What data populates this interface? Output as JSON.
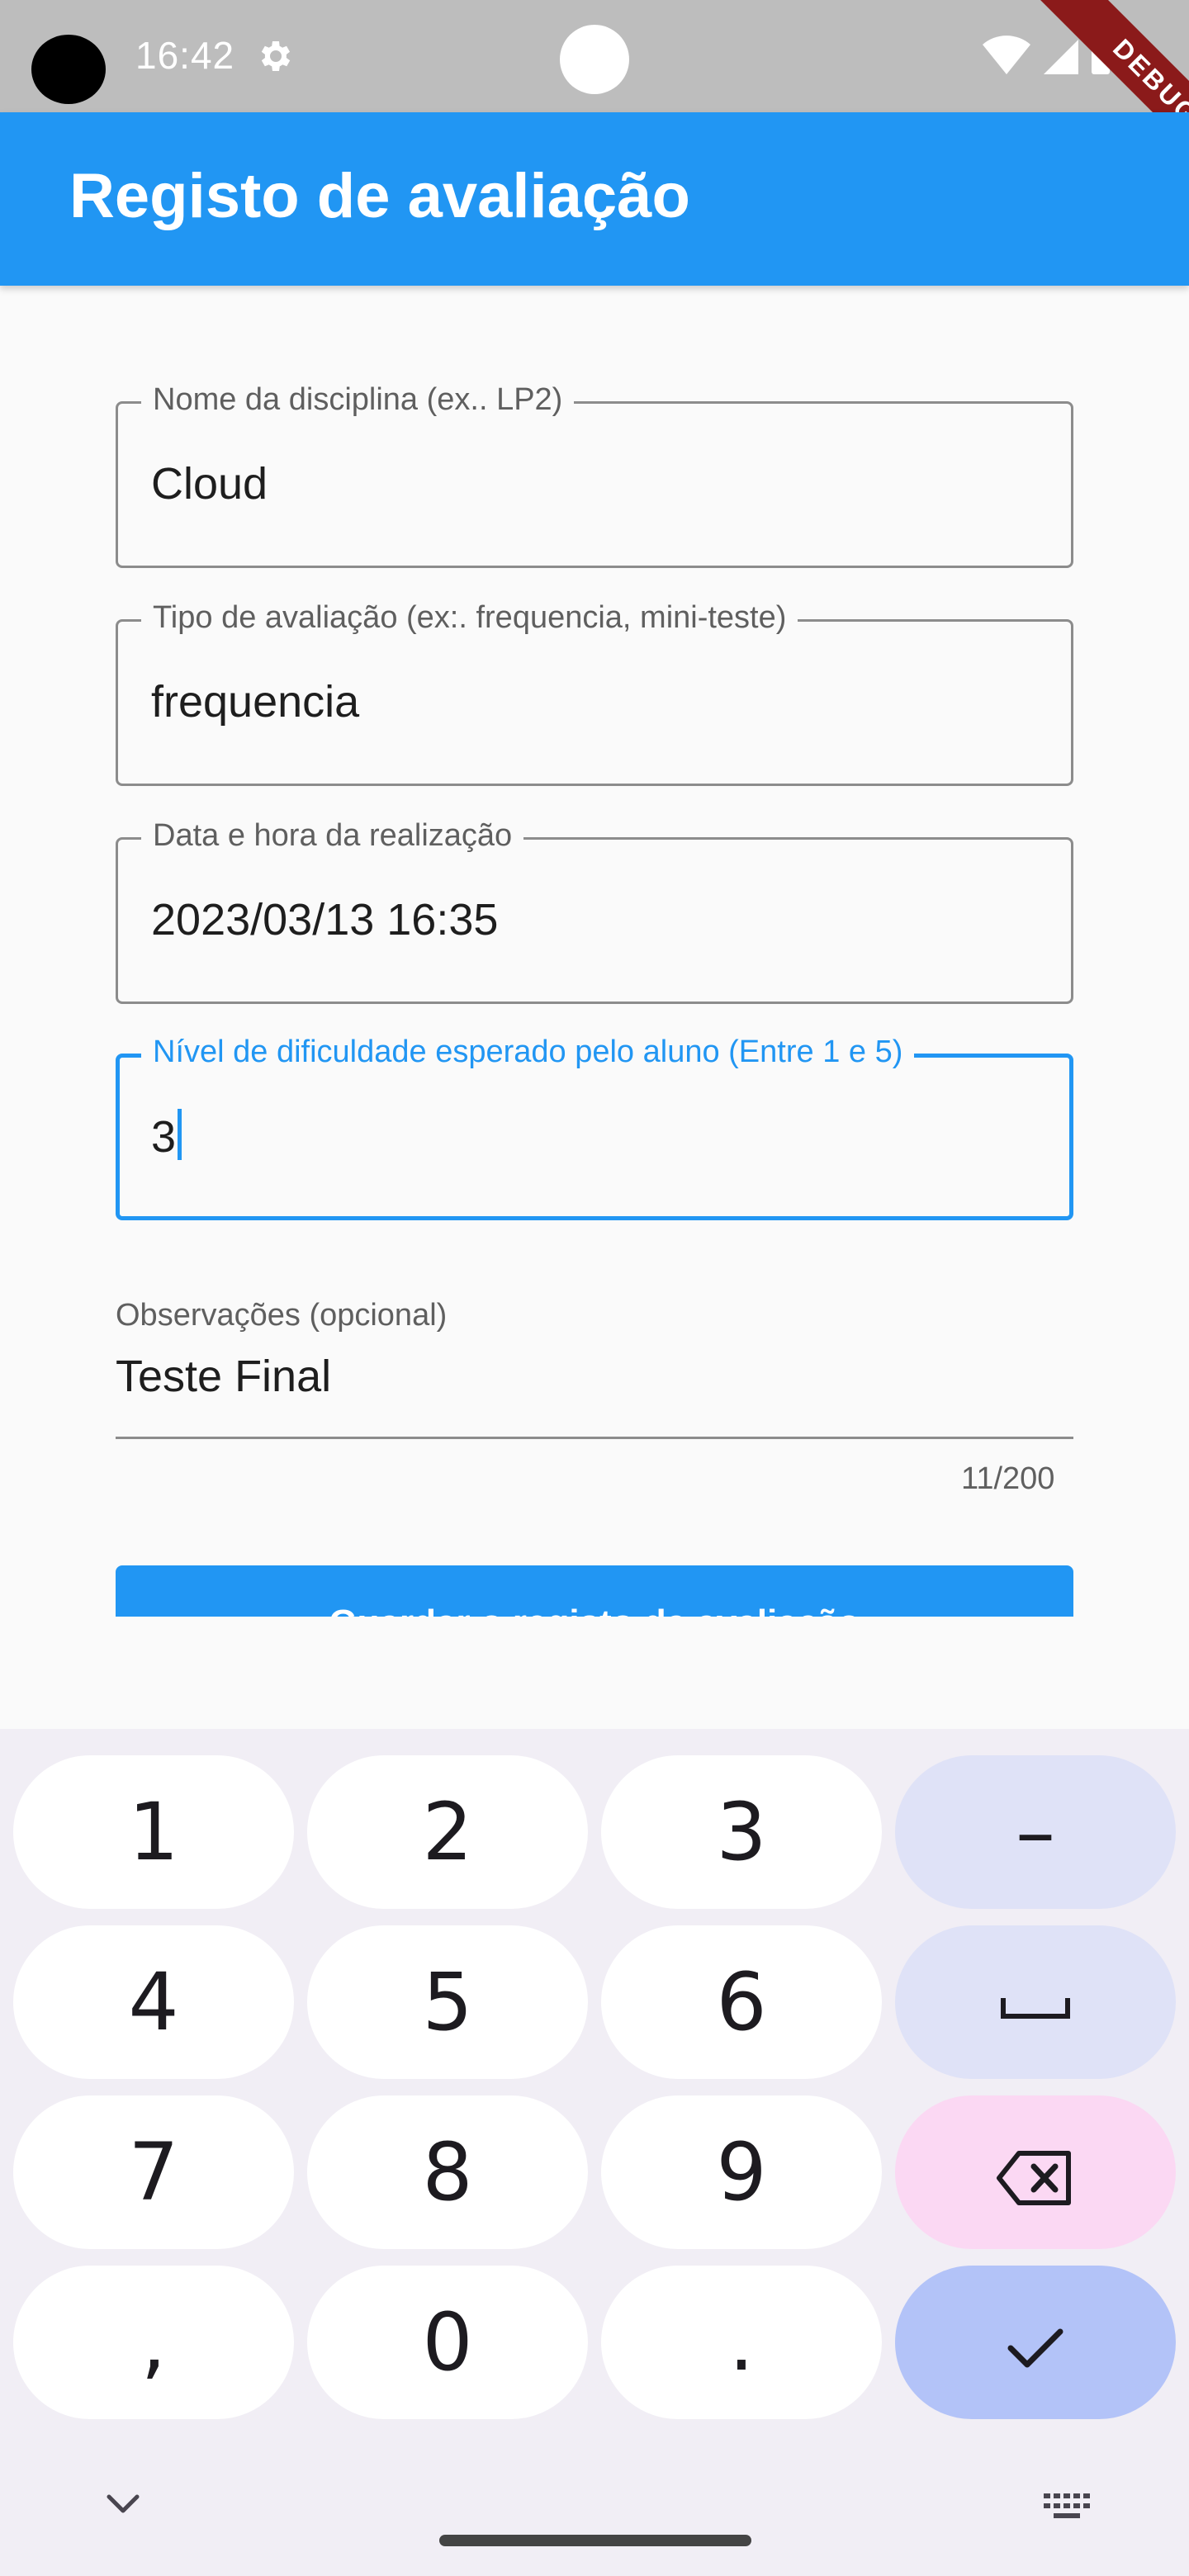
{
  "status_bar": {
    "time": "16:42"
  },
  "debug_banner": "DEBUG",
  "app_bar": {
    "title": "Registo de avaliação"
  },
  "form": {
    "fields": [
      {
        "label": "Nome da disciplina (ex.. LP2)",
        "value": "Cloud"
      },
      {
        "label": "Tipo de avaliação (ex:. frequencia, mini-teste)",
        "value": "frequencia"
      },
      {
        "label": "Data e hora da realização",
        "value": "2023/03/13 16:35"
      },
      {
        "label": "Nível de dificuldade esperado pelo aluno (Entre 1 e 5)",
        "value": "3"
      }
    ],
    "observations": {
      "label": "Observações (opcional)",
      "value": "Teste Final",
      "counter": "11/200"
    },
    "save_button": "Guardar o registo da avaliação"
  },
  "keyboard": {
    "rows": [
      [
        "1",
        "2",
        "3",
        "–"
      ],
      [
        "4",
        "5",
        "6",
        "␣"
      ],
      [
        "7",
        "8",
        "9",
        "⌫"
      ],
      [
        ",",
        "0",
        ".",
        "✓"
      ]
    ]
  },
  "colors": {
    "primary": "#2196f3",
    "status_bar": "#bdbdbd",
    "keyboard_bg": "#f1eef5"
  }
}
